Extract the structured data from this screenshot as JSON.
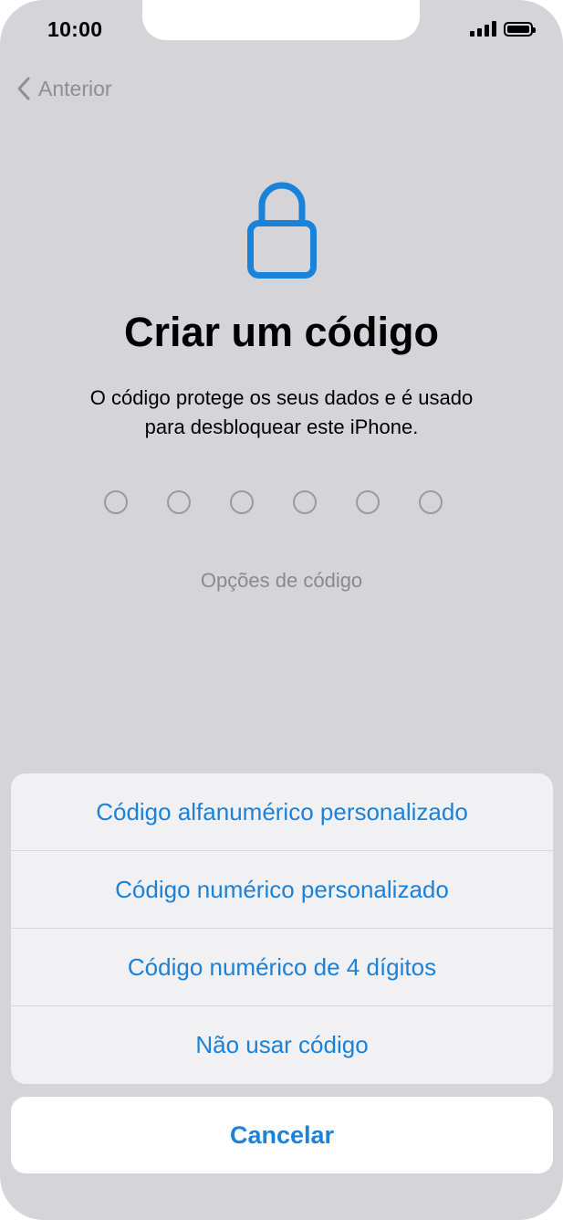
{
  "status_bar": {
    "time": "10:00"
  },
  "nav": {
    "back_label": "Anterior"
  },
  "main": {
    "title": "Criar um código",
    "description_line1": "O código protege os seus dados e é usado",
    "description_line2": "para desbloquear este iPhone.",
    "passcode_slots": 6,
    "options_link": "Opções de código"
  },
  "action_sheet": {
    "items": [
      {
        "label": "Código alfanumérico personalizado"
      },
      {
        "label": "Código numérico personalizado"
      },
      {
        "label": "Código numérico de 4 dígitos"
      },
      {
        "label": "Não usar código"
      }
    ],
    "cancel_label": "Cancelar"
  },
  "colors": {
    "accent": "#1a82d8",
    "background": "#d5d4d9",
    "sheet": "#f1f0f3"
  },
  "icons": {
    "back": "chevron-left-icon",
    "lock": "lock-icon",
    "signal": "cellular-signal-icon",
    "battery": "battery-icon"
  }
}
